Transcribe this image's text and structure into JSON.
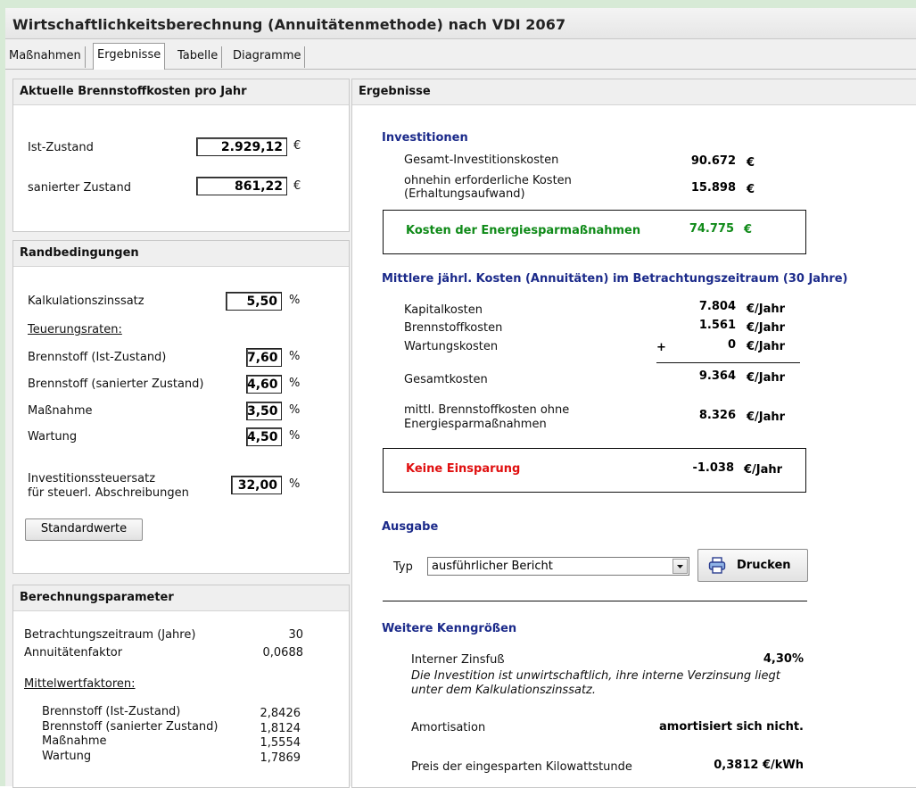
{
  "window": {
    "title": "Wirtschaftlichkeitsberechnung (Annuitätenmethode) nach VDI 2067"
  },
  "tabs": [
    "Maßnahmen",
    "Ergebnisse",
    "Tabelle",
    "Diagramme"
  ],
  "brennstoff": {
    "header": "Aktuelle Brennstoffkosten pro Jahr",
    "ist_label": "Ist-Zustand",
    "ist_value": "2.929,12",
    "ist_unit": "€",
    "saniert_label": "sanierter Zustand",
    "saniert_value": "861,22",
    "saniert_unit": "€"
  },
  "rand": {
    "header": "Randbedingungen",
    "zins_label": "Kalkulationszinssatz",
    "zins_value": "5,50",
    "teuerung_label": "Teuerungsraten:",
    "bs_ist_label": "Brennstoff (Ist-Zustand)",
    "bs_ist_value": "7,60",
    "bs_san_label": "Brennstoff (sanierter Zustand)",
    "bs_san_value": "4,60",
    "massnahme_label": "Maßnahme",
    "massnahme_value": "3,50",
    "wartung_label": "Wartung",
    "wartung_value": "4,50",
    "steuer_label1": "Investitionssteuersatz",
    "steuer_label2": "für steuerl. Abschreibungen",
    "steuer_value": "32,00",
    "percent": "%",
    "std_button": "Standardwerte"
  },
  "param": {
    "header": "Berechnungsparameter",
    "zeitraum_label": "Betrachtungszeitraum (Jahre)",
    "zeitraum_value": "30",
    "annu_label": "Annuitätenfaktor",
    "annu_value": "0,0688",
    "mittel_label": "Mittelwertfaktoren:",
    "rows": [
      {
        "label": "Brennstoff (Ist-Zustand)",
        "value": "2,8426"
      },
      {
        "label": "Brennstoff (sanierter Zustand)",
        "value": "1,8124"
      },
      {
        "label": "Maßnahme",
        "value": "1,5554"
      },
      {
        "label": "Wartung",
        "value": "1,7869"
      }
    ]
  },
  "erg": {
    "header": "Ergebnisse",
    "inv_title": "Investitionen",
    "gesamt_label": "Gesamt-Investitionskosten",
    "gesamt_value": "90.672",
    "euro": "€",
    "ohnehin_label1": "ohnehin erforderliche Kosten",
    "ohnehin_label2": "(Erhaltungsaufwand)",
    "ohnehin_value": "15.898",
    "kosten_label": "Kosten der Energiesparmaßnahmen",
    "kosten_value": "74.775",
    "mittl_title": "Mittlere jährl. Kosten (Annuitäten) im Betrachtungszeitraum (30 Jahre)",
    "kapital_label": "Kapitalkosten",
    "kapital_value": "7.804",
    "brenn_label": "Brennstoffkosten",
    "brenn_value": "1.561",
    "wartung_label": "Wartungskosten",
    "plus": "+",
    "wartung_value": "0",
    "gk_label": "Gesamtkosten",
    "gk_value": "9.364",
    "ohne_label1": "mittl. Brennstoffkosten ohne",
    "ohne_label2": "Energiesparmaßnahmen",
    "ohne_value": "8.326",
    "einsp_label": "Keine Einsparung",
    "einsp_value": "-1.038",
    "per_year": "€/Jahr",
    "ausgabe_title": "Ausgabe",
    "typ_label": "Typ",
    "typ_value": "ausführlicher Bericht",
    "drucken": "Drucken",
    "weitere_title": "Weitere Kenngrößen",
    "zinsfuss_label": "Interner Zinsfuß",
    "zinsfuss_value": "4,30%",
    "note1": "Die Investition ist unwirtschaftlich, ihre interne Verzinsung liegt",
    "note2": "unter dem Kalkulationszinssatz.",
    "amort_label": "Amortisation",
    "amort_value": "amortisiert sich nicht.",
    "preis_label": "Preis der eingesparten Kilowattstunde",
    "preis_value": "0,3812 €/kWh"
  },
  "colors": {
    "blue": "#1b2a8a",
    "green": "#0f8a18",
    "red": "#e01010",
    "frame": "#d7ead6"
  }
}
